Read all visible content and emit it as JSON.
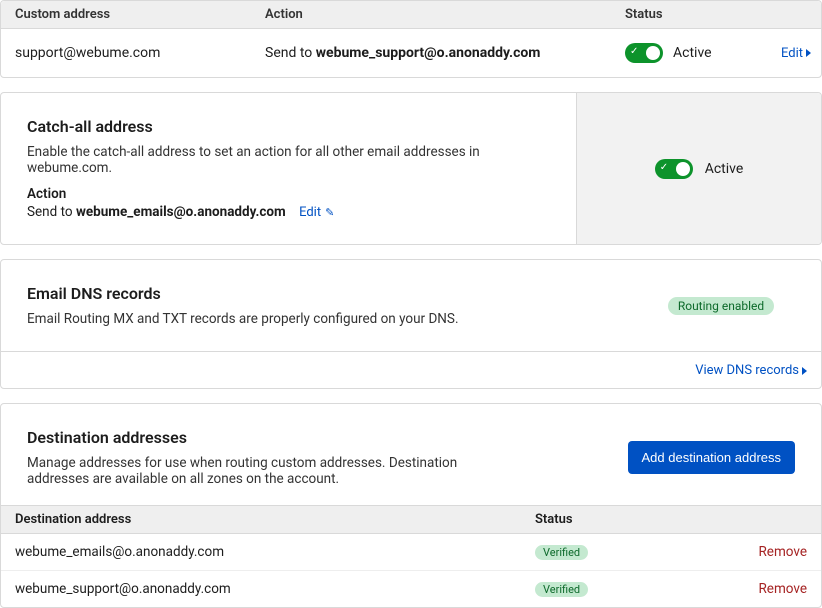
{
  "custom_addresses": {
    "headers": {
      "address": "Custom address",
      "action": "Action",
      "status": "Status"
    },
    "rows": [
      {
        "address": "support@webume.com",
        "action_prefix": "Send to ",
        "action_target": "webume_support@o.anonaddy.com",
        "status": "Active",
        "edit": "Edit"
      }
    ]
  },
  "catch_all": {
    "title": "Catch-all address",
    "description": "Enable the catch-all address to set an action for all other email addresses in webume.com.",
    "action_label": "Action",
    "send_prefix": "Send to ",
    "send_target": "webume_emails@o.anonaddy.com",
    "edit": "Edit",
    "status": "Active"
  },
  "dns": {
    "title": "Email DNS records",
    "description": "Email Routing MX and TXT records are properly configured on your DNS.",
    "badge": "Routing enabled",
    "view_link": "View DNS records"
  },
  "destinations": {
    "title": "Destination addresses",
    "description": "Manage addresses for use when routing custom addresses. Destination addresses are available on all zones on the account.",
    "add_button": "Add destination address",
    "headers": {
      "address": "Destination address",
      "status": "Status"
    },
    "rows": [
      {
        "address": "webume_emails@o.anonaddy.com",
        "status": "Verified",
        "remove": "Remove"
      },
      {
        "address": "webume_support@o.anonaddy.com",
        "status": "Verified",
        "remove": "Remove"
      }
    ]
  }
}
